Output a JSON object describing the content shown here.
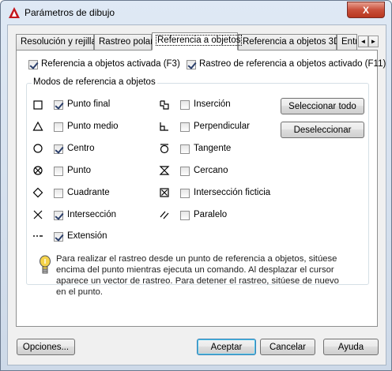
{
  "window": {
    "title": "Parámetros de dibujo",
    "close_label": "X"
  },
  "tabs": [
    {
      "label": "Resolución y rejilla"
    },
    {
      "label": "Rastreo polar"
    },
    {
      "label": "Referencia a objetos"
    },
    {
      "label": "Referencia a objetos 3D"
    },
    {
      "label": "Entr"
    }
  ],
  "tab_scroll": {
    "left": "◄",
    "right": "►"
  },
  "top_options": {
    "osnap_on": {
      "label": "Referencia a objetos activada (F3)",
      "checked": true
    },
    "osnap_track": {
      "label": "Rastreo de referencia a objetos activado (F11)",
      "checked": true
    }
  },
  "group": {
    "title": "Modos de referencia a objetos",
    "left_modes": [
      {
        "label": "Punto final",
        "checked": true,
        "icon": "square-icon"
      },
      {
        "label": "Punto medio",
        "checked": false,
        "icon": "triangle-icon"
      },
      {
        "label": "Centro",
        "checked": true,
        "icon": "circle-icon"
      },
      {
        "label": "Punto",
        "checked": false,
        "icon": "node-icon"
      },
      {
        "label": "Cuadrante",
        "checked": false,
        "icon": "diamond-icon"
      },
      {
        "label": "Intersección",
        "checked": true,
        "icon": "x-icon"
      },
      {
        "label": "Extensión",
        "checked": true,
        "icon": "extension-icon"
      }
    ],
    "right_modes": [
      {
        "label": "Inserción",
        "checked": false,
        "icon": "insertion-icon"
      },
      {
        "label": "Perpendicular",
        "checked": false,
        "icon": "perpendicular-icon"
      },
      {
        "label": "Tangente",
        "checked": false,
        "icon": "tangent-icon"
      },
      {
        "label": "Cercano",
        "checked": false,
        "icon": "nearest-icon"
      },
      {
        "label": "Intersección ficticia",
        "checked": false,
        "icon": "apparent-intersection-icon"
      },
      {
        "label": "Paralelo",
        "checked": false,
        "icon": "parallel-icon"
      }
    ],
    "select_all": "Seleccionar todo",
    "clear_all": "Deseleccionar",
    "hint": "Para realizar el rastreo desde un punto de referencia a objetos, sitúese encima del punto mientras ejecuta un comando. Al desplazar el cursor aparece un vector de rastreo. Para detener el rastreo, sitúese de nuevo en el punto."
  },
  "footer": {
    "options": "Opciones...",
    "ok": "Aceptar",
    "cancel": "Cancelar",
    "help": "Ayuda"
  }
}
